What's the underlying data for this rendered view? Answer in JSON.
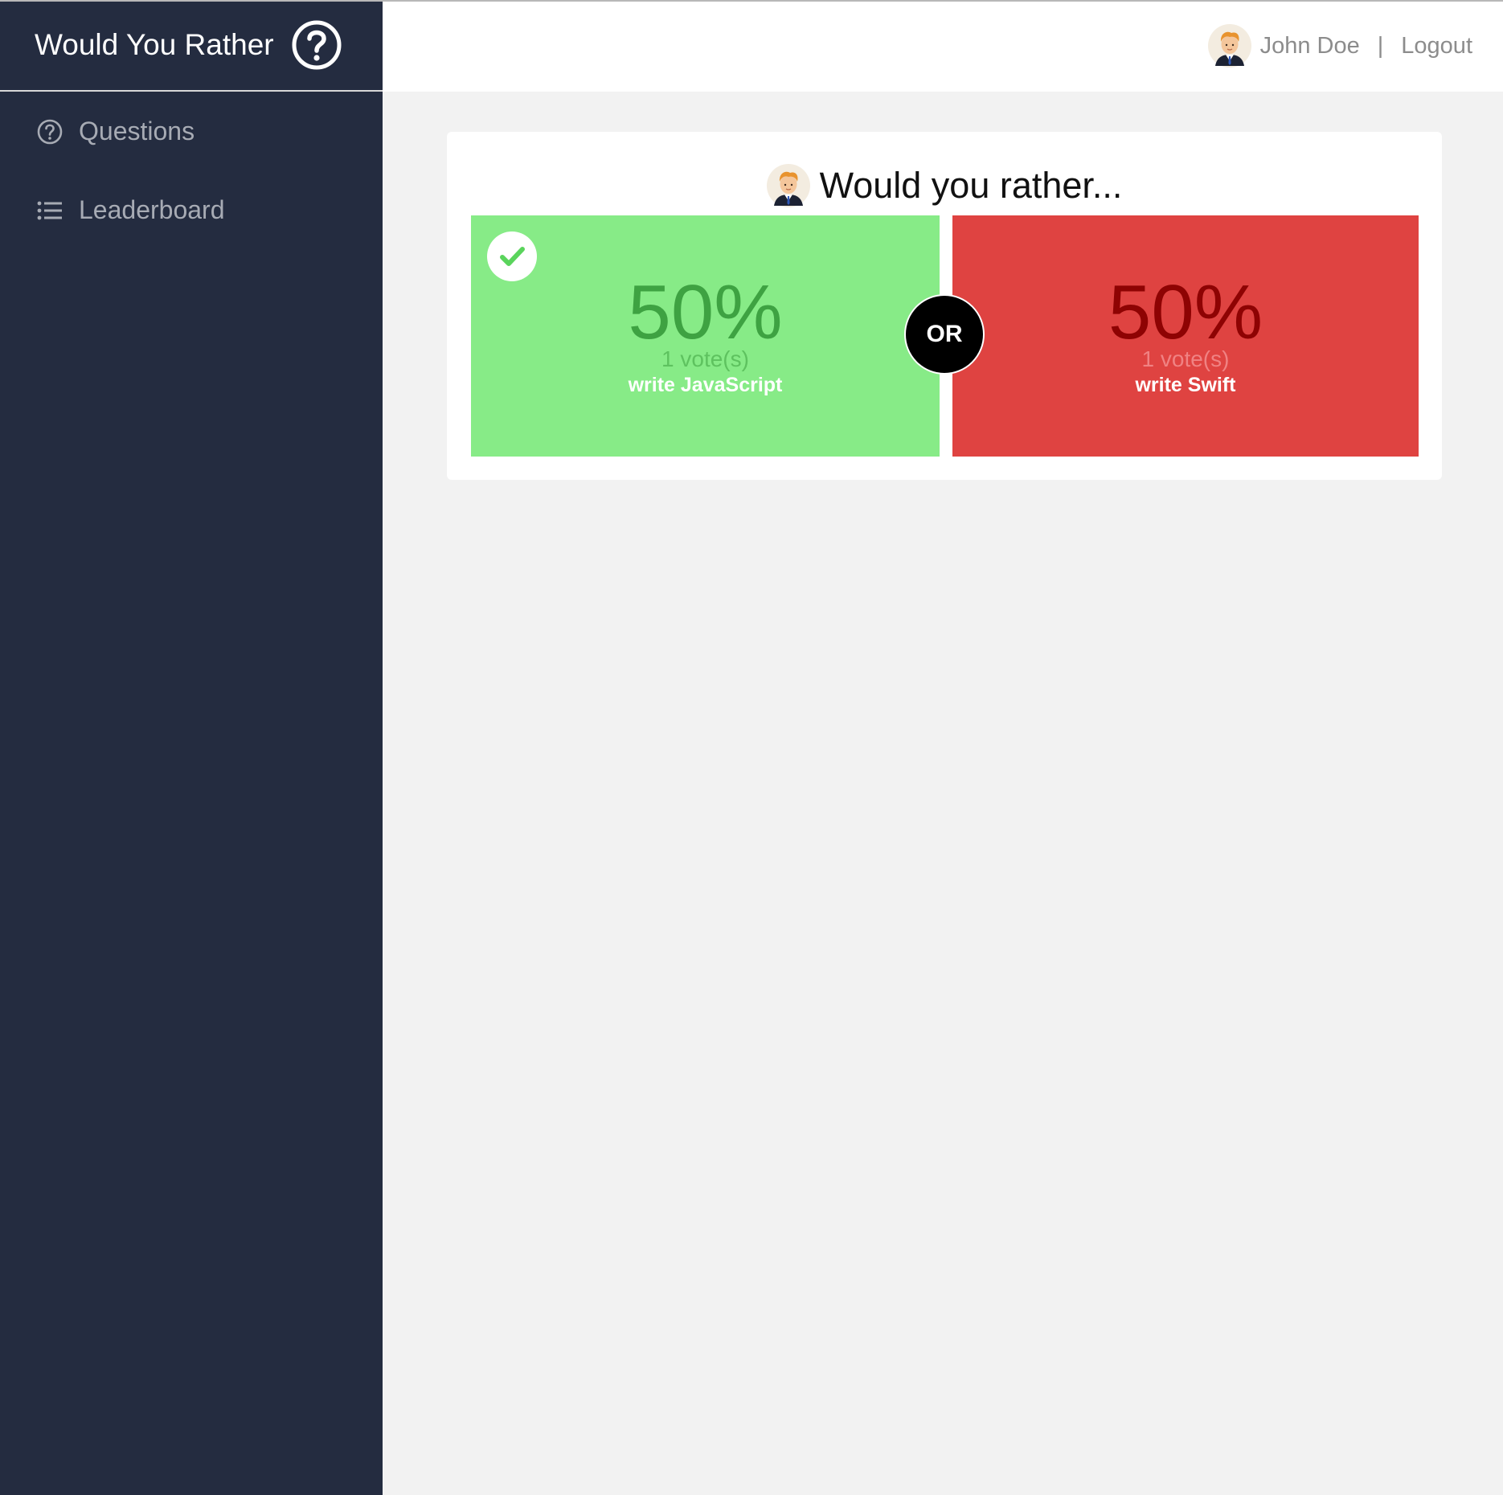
{
  "app": {
    "title": "Would You Rather"
  },
  "sidebar": {
    "items": [
      {
        "label": "Questions",
        "icon": "question-circle-icon"
      },
      {
        "label": "Leaderboard",
        "icon": "list-icon"
      }
    ]
  },
  "header": {
    "user_name": "John Doe",
    "separator": "|",
    "logout_label": "Logout"
  },
  "poll": {
    "title": "Would you rather...",
    "or_label": "OR",
    "options": [
      {
        "percent": "50%",
        "votes": "1 vote(s)",
        "text": "write JavaScript",
        "selected": true,
        "color": "#87eb87"
      },
      {
        "percent": "50%",
        "votes": "1 vote(s)",
        "text": "write Swift",
        "selected": false,
        "color": "#df4341"
      }
    ]
  },
  "colors": {
    "sidebar_bg": "#242c40",
    "page_bg": "#f2f2f2",
    "option_one_bg": "#87eb87",
    "option_two_bg": "#df4341"
  }
}
